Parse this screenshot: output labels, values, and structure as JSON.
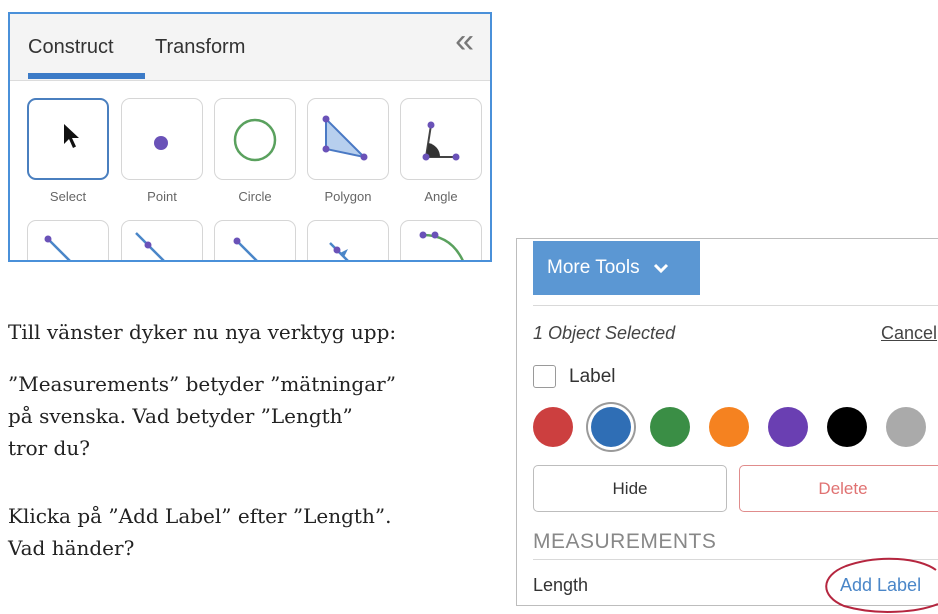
{
  "tools_panel": {
    "tabs": [
      {
        "label": "Construct",
        "active": true
      },
      {
        "label": "Transform",
        "active": false
      }
    ],
    "collapse_icon": "double-chevron-left-icon",
    "tools": [
      {
        "label": "Select",
        "icon": "arrow-cursor-icon",
        "selected": true
      },
      {
        "label": "Point",
        "icon": "point-icon",
        "selected": false
      },
      {
        "label": "Circle",
        "icon": "circle-icon",
        "selected": false
      },
      {
        "label": "Polygon",
        "icon": "polygon-icon",
        "selected": false
      },
      {
        "label": "Angle",
        "icon": "angle-icon",
        "selected": false
      }
    ],
    "second_row_icons": [
      "segment-icon",
      "line-icon",
      "ray-icon",
      "vector-icon",
      "arc-icon"
    ]
  },
  "instructions": {
    "p1": "Till vänster dyker nu nya verktyg upp:",
    "p2_l1": "”Measurements” betyder ”mätningar”",
    "p2_l2": "på svenska. Vad betyder ”Length”",
    "p2_l3": "tror du?",
    "p3_l1": "Klicka på ”Add Label” efter ”Length”.",
    "p3_l2": "Vad händer?"
  },
  "object_panel": {
    "more_tools_label": "More Tools",
    "selected_text": "1 Object Selected",
    "cancel_label": "Cancel",
    "label_checkbox": {
      "label": "Label",
      "checked": false
    },
    "colors": [
      "#cc3f3f",
      "#2f6eb5",
      "#3a8e45",
      "#f58220",
      "#6a3fb2",
      "#000000",
      "#aaaaaa"
    ],
    "selected_color_index": 1,
    "hide_label": "Hide",
    "delete_label": "Delete",
    "measurements_heading": "MEASUREMENTS",
    "length_label": "Length",
    "add_label_label": "Add Label"
  },
  "colors": {
    "accent": "#4a90d9",
    "button_blue": "#5b97d3",
    "annotation_red": "#b5263f"
  }
}
